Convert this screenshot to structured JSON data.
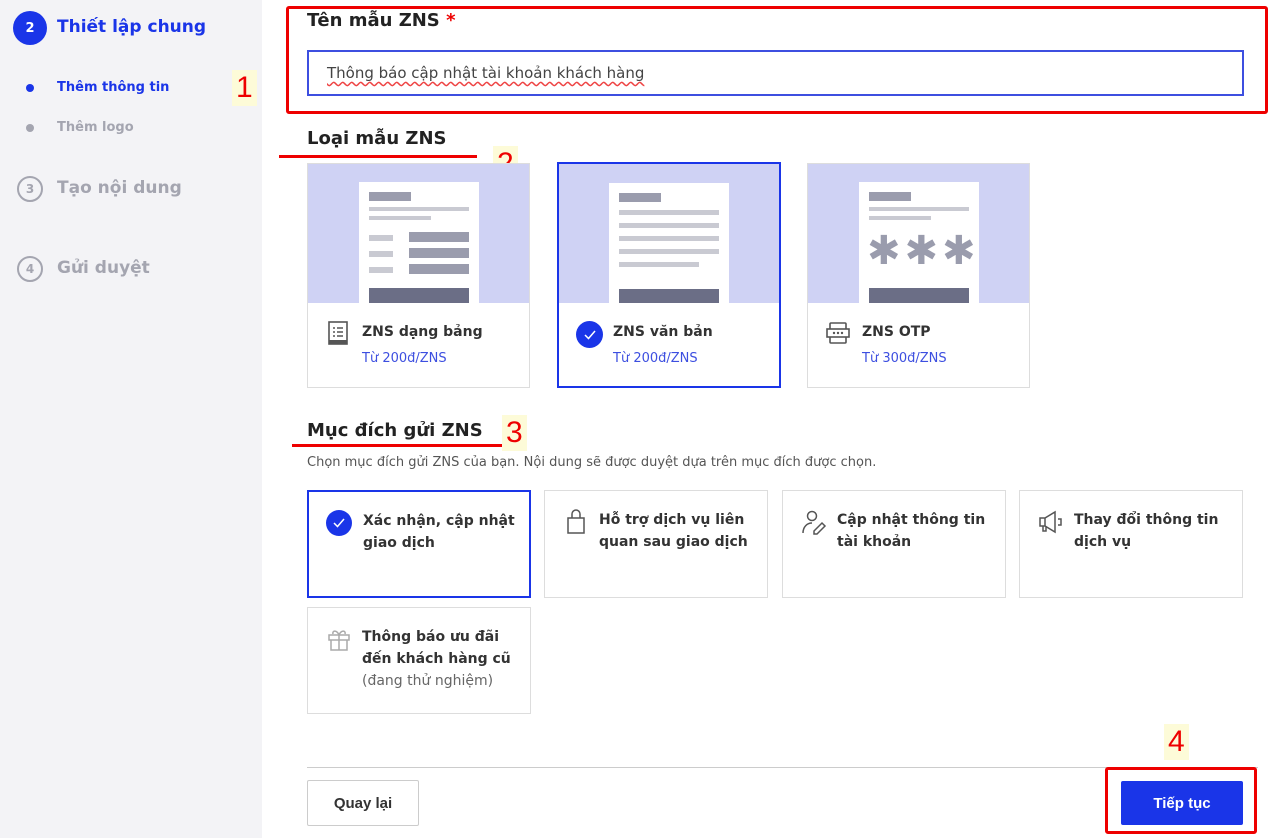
{
  "sidebar": {
    "steps": [
      {
        "num": "2",
        "label": "Thiết lập chung",
        "active": true,
        "sub": [
          {
            "label": "Thêm thông tin",
            "active": true
          },
          {
            "label": "Thêm logo",
            "active": false
          }
        ]
      },
      {
        "num": "3",
        "label": "Tạo nội dung",
        "active": false
      },
      {
        "num": "4",
        "label": "Gửi duyệt",
        "active": false
      }
    ]
  },
  "form": {
    "name_label": "Tên mẫu ZNS",
    "required_mark": "*",
    "name_value": "Thông báo cập nhật tài khoản khách hàng",
    "type_title": "Loại mẫu ZNS",
    "types": [
      {
        "name": "ZNS dạng bảng",
        "price": "Từ 200đ/ZNS",
        "icon": "table-doc-icon",
        "selected": false
      },
      {
        "name": "ZNS văn bản",
        "price": "Từ 200đ/ZNS",
        "icon": "check-icon",
        "selected": true
      },
      {
        "name": "ZNS OTP",
        "price": "Từ 300đ/ZNS",
        "icon": "otp-icon",
        "selected": false
      }
    ],
    "purpose_title": "Mục đích gửi ZNS",
    "purpose_desc": "Chọn mục đích gửi ZNS của bạn. Nội dung sẽ được duyệt dựa trên mục đích được chọn.",
    "purposes": [
      {
        "label": "Xác nhận, cập nhật giao dịch",
        "icon": "check-icon",
        "selected": true
      },
      {
        "label": "Hỗ trợ dịch vụ liên quan sau giao dịch",
        "icon": "shopping-bag-icon",
        "selected": false
      },
      {
        "label": "Cập nhật thông tin tài khoản",
        "icon": "user-edit-icon",
        "selected": false
      },
      {
        "label": "Thay đổi thông tin dịch vụ",
        "icon": "megaphone-icon",
        "selected": false
      },
      {
        "label": "Thông báo ưu đãi đến khách hàng cũ",
        "note": "(đang thử nghiệm)",
        "icon": "gift-icon",
        "selected": false
      }
    ]
  },
  "footer": {
    "back_label": "Quay lại",
    "next_label": "Tiếp tục"
  },
  "annotations": [
    "1",
    "2",
    "3",
    "4"
  ],
  "colors": {
    "accent": "#1a35e8",
    "annotation": "#e00000",
    "sidebar_bg": "#f3f3f6",
    "preview_bg": "#cfd2f4"
  }
}
